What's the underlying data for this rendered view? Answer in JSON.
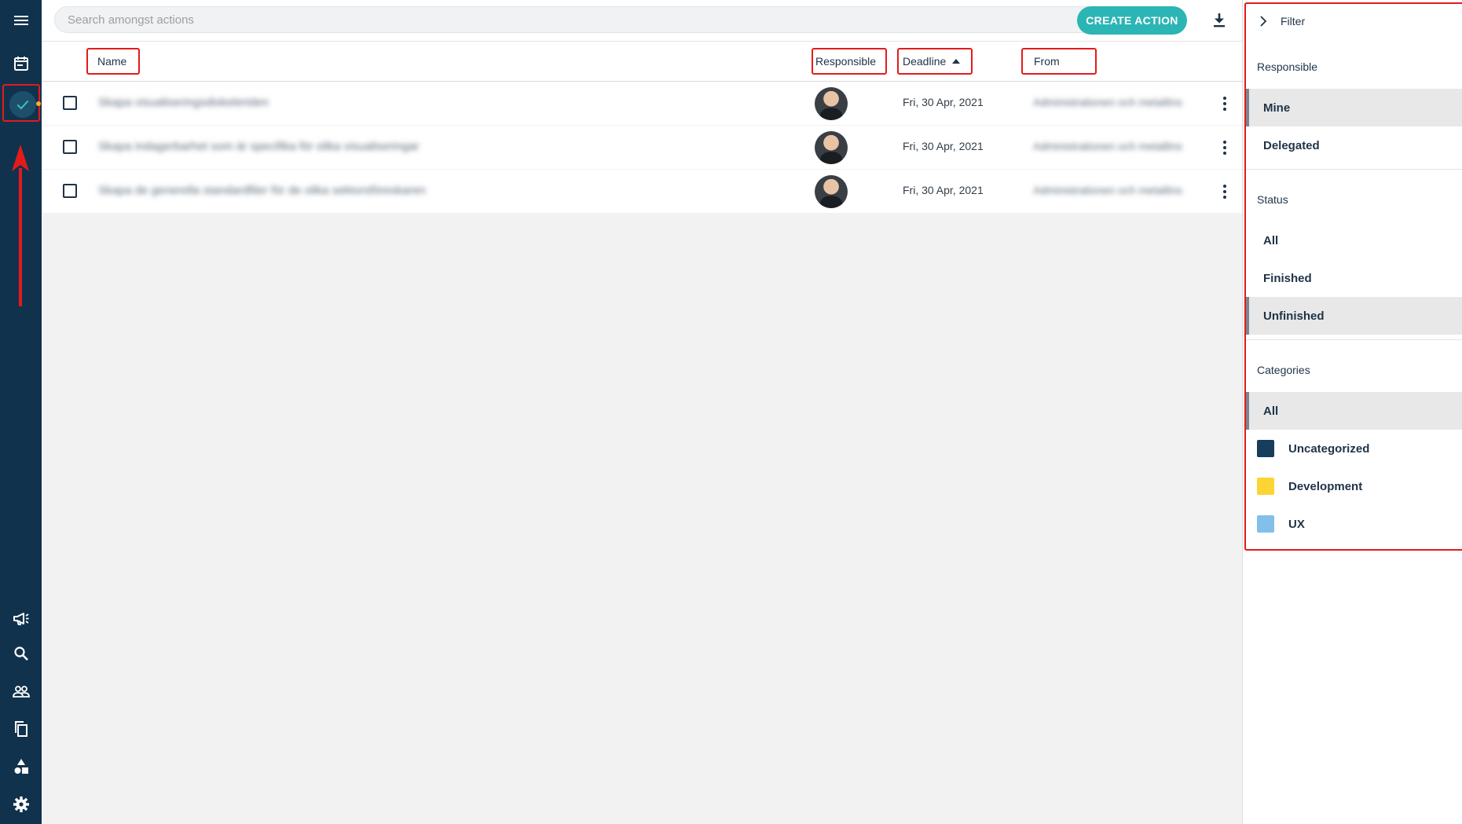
{
  "search": {
    "placeholder": "Search amongst actions"
  },
  "toolbar": {
    "create_label": "CREATE ACTION"
  },
  "table": {
    "columns": {
      "name": "Name",
      "responsible": "Responsible",
      "deadline": "Deadline",
      "from": "From"
    },
    "rows": [
      {
        "name": "Skapa visualiseringsdiskeleriden",
        "deadline": "Fri, 30 Apr, 2021",
        "from": "Administrationen och metallins"
      },
      {
        "name": "Skapa indagerbarhet som är specifika för olika visualiseringar",
        "deadline": "Fri, 30 Apr, 2021",
        "from": "Administrationen och metallins"
      },
      {
        "name": "Skapa de generella standardfiler för de olika sektorsföreskaren",
        "deadline": "Fri, 30 Apr, 2021",
        "from": "Administrationen och metallins"
      }
    ]
  },
  "filter": {
    "title": "Filter",
    "responsible": {
      "label": "Responsible",
      "options": [
        "Mine",
        "Delegated"
      ],
      "selected": "Mine"
    },
    "status": {
      "label": "Status",
      "options": [
        "All",
        "Finished",
        "Unfinished"
      ],
      "selected": "Unfinished"
    },
    "categories": {
      "label": "Categories",
      "all_label": "All",
      "items": [
        {
          "name": "Uncategorized",
          "color": "#163d5c"
        },
        {
          "name": "Development",
          "color": "#fcd535"
        },
        {
          "name": "UX",
          "color": "#82bfea"
        }
      ]
    }
  },
  "colors": {
    "rail": "#11324d",
    "accent": "#2bb5b5",
    "highlight_border": "#e31b1b"
  }
}
